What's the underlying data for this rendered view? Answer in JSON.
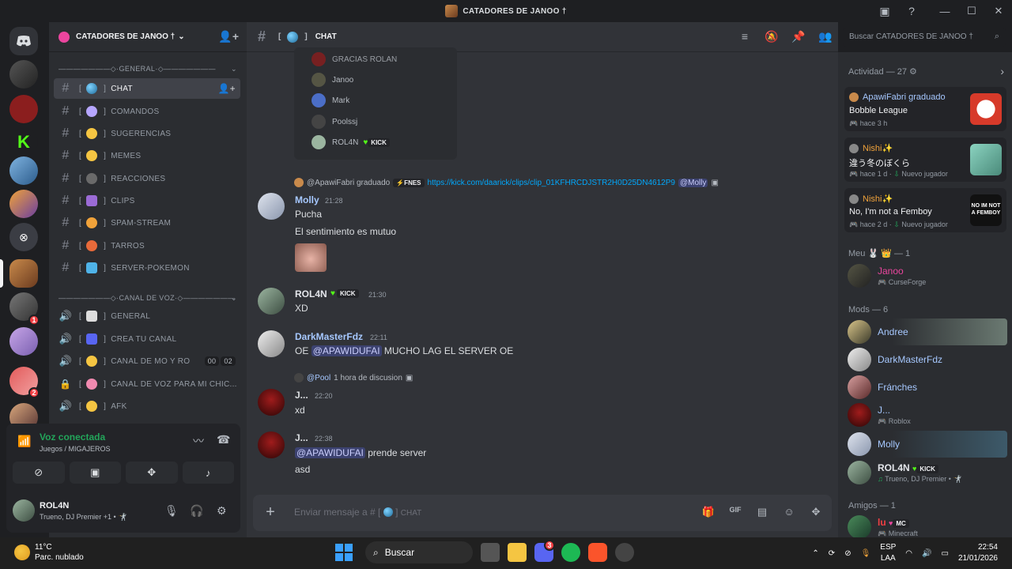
{
  "window": {
    "title": "CATADORES DE JANOO †"
  },
  "guild": {
    "name": "CATADORES DE JANOO †",
    "categories": [
      {
        "label": "———————◇·GENERAL·◇———————"
      },
      {
        "label": "———————◇·CANAL DE VOZ·◇———————"
      }
    ],
    "text_channels": [
      {
        "label": "CHAT",
        "active": true
      },
      {
        "label": "COMANDOS"
      },
      {
        "label": "SUGERENCIAS"
      },
      {
        "label": "MEMES"
      },
      {
        "label": "REACCIONES"
      },
      {
        "label": "CLIPS"
      },
      {
        "label": "SPAM-STREAM"
      },
      {
        "label": "TARROS"
      },
      {
        "label": "SERVER-POKEMON"
      }
    ],
    "voice_channels": [
      {
        "label": "GENERAL"
      },
      {
        "label": "CREA TU CANAL"
      },
      {
        "label": "CANAL DE MO Y RO",
        "count_a": "00",
        "count_b": "02"
      },
      {
        "label": "CANAL DE VOZ PARA MI CHIC..."
      },
      {
        "label": "AFK"
      }
    ],
    "server_badges": [
      "1",
      "2"
    ]
  },
  "voice": {
    "status": "Voz conectada",
    "location": "Juegos / MIGAJEROS"
  },
  "user": {
    "name": "ROL4N",
    "status": "Trueno, DJ Premier +1 • 🤺"
  },
  "channel": {
    "name": "CHAT",
    "composer_placeholder": "Enviar mensaje a #  [",
    "composer_channel": "CHAT"
  },
  "search": {
    "placeholder": "Buscar CATADORES DE JANOO †"
  },
  "poll": {
    "rows": [
      "GRACIAS ROLAN",
      "Janoo",
      "Mark",
      "Poolssj",
      "ROL4N"
    ],
    "tag": "KICK"
  },
  "messages": [
    {
      "reply_user": "@ApawiFabri graduado",
      "reply_tag": "⚡FNES",
      "reply_link": "https://kick.com/daarick/clips/clip_01KFHRCDJSTR2H0D25DN4612P9",
      "reply_mention": "@Molly",
      "author": "Molly",
      "time": "21:28",
      "lines": [
        "Pucha",
        "El sentimiento es mutuo"
      ]
    },
    {
      "author": "ROL4N",
      "tag": "KICK",
      "time": "21:30",
      "lines": [
        "XD"
      ]
    },
    {
      "author": "DarkMasterFdz",
      "time": "22:11",
      "prefix": "OE",
      "mention": "@APAWIDUFAI",
      "suffix": "MUCHO LAG EL SERVER OE"
    },
    {
      "reply_user": "@Pool",
      "reply_text": "1 hora de discusion",
      "author": "J...",
      "time": "22:20",
      "lines": [
        "xd"
      ]
    },
    {
      "author": "J...",
      "time": "22:38",
      "mention": "@APAWIDUFAI",
      "suffix": "prende server",
      "lines": [
        "asd"
      ]
    }
  ],
  "members": {
    "activity_header": "Actividad — 27",
    "activities": [
      {
        "who": "ApawiFabri graduado",
        "what": "Bobble League",
        "when": "hace 3 h"
      },
      {
        "who": "Nishi✨",
        "what": "違う冬のぼくら",
        "when": "hace 1 d",
        "extra": "Nuevo jugador"
      },
      {
        "who": "Nishi✨",
        "what": "No, I'm not a Femboy",
        "when": "hace 2 d",
        "extra": "Nuevo jugador",
        "thumb_text": "NO IM NOT A FEMBOY"
      }
    ],
    "sections": [
      {
        "label": "Meu 🐰 👑 — 1"
      },
      {
        "label": "Mods — 6"
      },
      {
        "label": "Amigos — 1"
      }
    ],
    "meu": [
      {
        "name": "Janoo",
        "status": "CurseForge"
      }
    ],
    "mods": [
      {
        "name": "Andree"
      },
      {
        "name": "DarkMasterFdz"
      },
      {
        "name": "Fránches"
      },
      {
        "name": "J...",
        "status": "Roblox"
      },
      {
        "name": "Molly"
      },
      {
        "name": "ROL4N",
        "tag": "KICK",
        "status": "Trueno, DJ Premier • 🤺"
      }
    ],
    "friends": [
      {
        "name": "lu",
        "tag": "MC",
        "status": "Minecraft"
      }
    ]
  },
  "taskbar": {
    "temp": "11°C",
    "weather": "Parc. nublado",
    "search": "Buscar",
    "lang1": "ESP",
    "lang2": "LAA",
    "time": "22:54",
    "date": "21/01/2026",
    "discord_badge": "3"
  },
  "colors": {
    "mention_bg": "#3c4270",
    "voice_green": "#23a55a",
    "link": "#00a8fc",
    "molly": "#a6c8ff",
    "rol4n": "#e4e6eb",
    "janoo": "#eb459e"
  }
}
